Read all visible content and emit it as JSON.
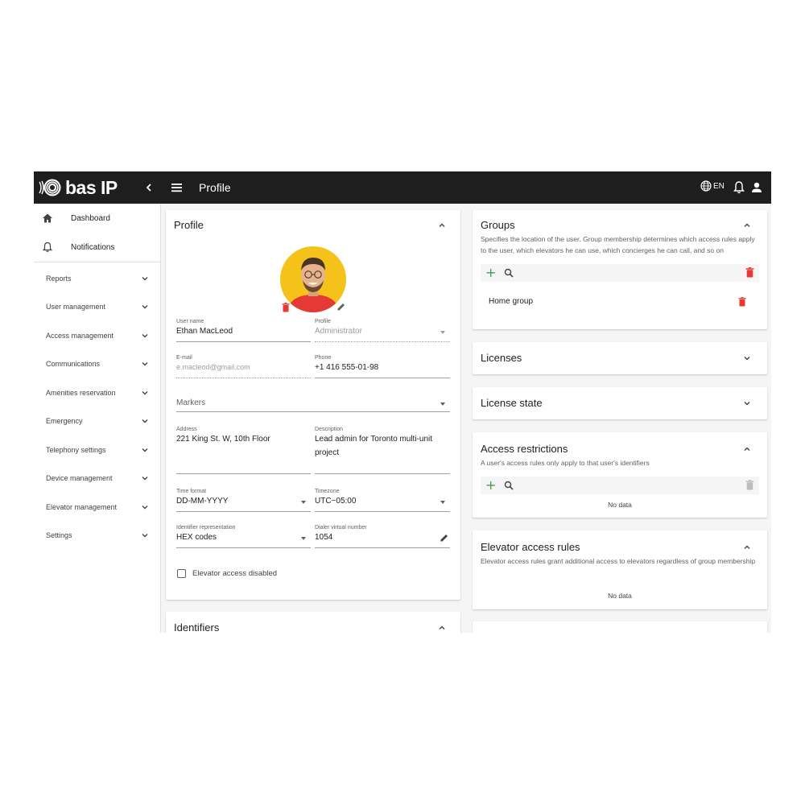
{
  "app": {
    "logo_text": "bas IP",
    "page_title": "Profile",
    "language": "EN"
  },
  "sidebar": {
    "top_items": [
      {
        "label": "Dashboard",
        "icon": "home-icon"
      },
      {
        "label": "Notifications",
        "icon": "bell-icon"
      }
    ],
    "groups": [
      "Reports",
      "User management",
      "Access management",
      "Communications",
      "Amenities reservation",
      "Emergency",
      "Telephony settings",
      "Device management",
      "Elevator management",
      "Settings"
    ]
  },
  "profile": {
    "title": "Profile",
    "user_name": {
      "label": "User name",
      "value": "Ethan MacLeod"
    },
    "profile_type": {
      "label": "Profile",
      "value": "Administrator"
    },
    "email": {
      "label": "E-mail",
      "value": "e.macleod@gmail.com"
    },
    "phone": {
      "label": "Phone",
      "value": "+1 416 555-01-98"
    },
    "markers": {
      "placeholder": "Markers"
    },
    "address": {
      "label": "Address",
      "value": "221 King St. W, 10th Floor"
    },
    "description": {
      "label": "Description",
      "line1": "Lead admin for Toronto multi-unit",
      "line2": "project"
    },
    "time_format": {
      "label": "Time format",
      "value": "DD-MM-YYYY"
    },
    "timezone": {
      "label": "Timezone",
      "value": "UTC−05:00"
    },
    "identifier_repr": {
      "label": "Identifier representation",
      "value": "HEX codes"
    },
    "dialer": {
      "label": "Dialer virtual number",
      "value": "1054"
    },
    "elevator_access": {
      "label": "Elevator access disabled",
      "checked": false
    }
  },
  "identifiers": {
    "title": "Identifiers"
  },
  "groups": {
    "title": "Groups",
    "description": "Specifies the location of the user. Group membership determines which access rules apply to the user, which elevators he can use, which concierges he can call, and so on",
    "items": [
      "Home group"
    ]
  },
  "licenses": {
    "title": "Licenses"
  },
  "license_state": {
    "title": "License state"
  },
  "access_restrictions": {
    "title": "Access restrictions",
    "description": "A user's access rules only apply to that user's identifiers",
    "empty": "No data"
  },
  "elevator_rules": {
    "title": "Elevator access rules",
    "description": "Elevator access rules grant additional access to elevators regardless of group membership",
    "empty": "No data"
  },
  "colors": {
    "topbar": "#1e1e1e",
    "avatar_bg": "#f4c21b",
    "add": "#43a047",
    "delete": "#e53935"
  }
}
